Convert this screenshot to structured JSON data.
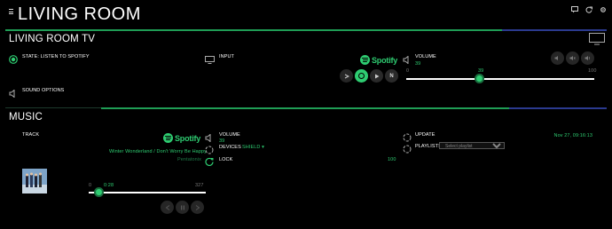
{
  "header": {
    "title": "LIVING ROOM",
    "icons": [
      "chat-icon",
      "refresh-icon",
      "settings-icon"
    ]
  },
  "tv": {
    "title": "LIVING ROOM TV",
    "state_label": "STATE: LISTEN TO SPOTIFY",
    "input_label": "INPUT",
    "sound_options_label": "SOUND OPTIONS",
    "volume_label": "VOLUME",
    "volume_value": "39",
    "volume_min": "0",
    "volume_max": "100",
    "volume_knob_label": "39",
    "volume_level": 0.39,
    "spotify_word": "Spotify",
    "input_buttons": [
      "arrow-icon",
      "spotify-icon",
      "play-icon",
      "netflix-icon"
    ],
    "netflix_letter": "N",
    "volume_buttons": [
      "volume-down-icon",
      "mute-icon",
      "volume-up-icon"
    ]
  },
  "music": {
    "title": "MUSIC",
    "track_label": "TRACK",
    "spotify_word": "Spotify",
    "track_title": "Winter Wonderland / Don't Worry Be Happy",
    "artist": "Pentatonix",
    "progress_start": "0",
    "progress_current": "0:28",
    "progress_end": "327",
    "progress_level": 0.086,
    "volume_label": "VOLUME",
    "volume_value": "39",
    "devices_label": "DEVICES",
    "devices_value": "SHIELD ▾",
    "lock_label": "LOCK",
    "lock_value": "100",
    "update_label": "UPDATE",
    "update_value": "Nov 27, 09:16:13",
    "playlists_label": "PLAYLISTS",
    "playlists_placeholder": "Select playlist"
  },
  "colors": {
    "accent": "#2ecc71",
    "panel_bar_green": "#1f9d55",
    "panel_bar_blue": "#2b3a8f"
  }
}
